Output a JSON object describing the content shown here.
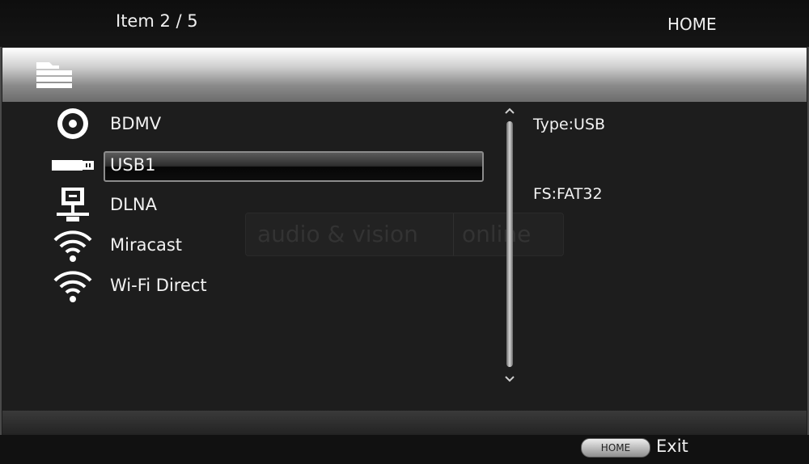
{
  "top_bar": {
    "item_counter": "Item  2  /  5",
    "home_title": "HOME"
  },
  "header": {
    "icon": "folder-icon"
  },
  "device_list": {
    "selected_index": 1,
    "items": [
      {
        "label": "BDMV",
        "icon": "disc-icon"
      },
      {
        "label": "USB1",
        "icon": "usb-drive-icon"
      },
      {
        "label": "DLNA",
        "icon": "network-pc-icon"
      },
      {
        "label": "Miracast",
        "icon": "wifi-icon"
      },
      {
        "label": "Wi-Fi Direct",
        "icon": "wifi-icon"
      }
    ]
  },
  "info": {
    "type": "Type:USB",
    "fs": "FS:FAT32"
  },
  "watermark": {
    "left": "audio & vision",
    "right": "online"
  },
  "footer": {
    "home_button": "HOME",
    "exit_label": "Exit"
  },
  "colors": {
    "background": "#1c1c1c",
    "text": "#f2f2f2",
    "header_bar": "#d0d0d0"
  }
}
